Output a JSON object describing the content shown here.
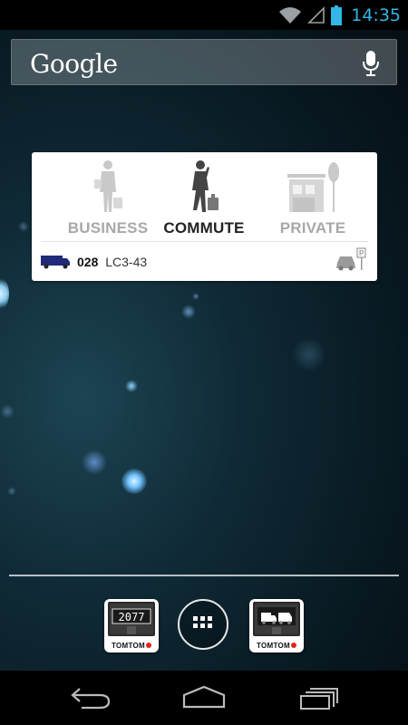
{
  "status_bar": {
    "time": "14:35",
    "icons": [
      "wifi-icon",
      "signal-icon",
      "battery-icon"
    ],
    "accent_color": "#33b5e5"
  },
  "search": {
    "logo_text": "Google",
    "icon": "mic-icon"
  },
  "widget": {
    "modes": [
      {
        "label": "BUSINESS",
        "icon": "businessman-icon",
        "active": false
      },
      {
        "label": "COMMUTE",
        "icon": "commuter-icon",
        "active": true
      },
      {
        "label": "PRIVATE",
        "icon": "house-icon",
        "active": false
      }
    ],
    "route": {
      "number": "028",
      "code": "LC3-43",
      "vehicle_icon": "truck-icon",
      "parking_icon": "car-parking-icon"
    }
  },
  "dock": {
    "apps": [
      {
        "name": "TomTom odometer app",
        "brand": "TOMTOM",
        "screen_text": "2077",
        "icon": "odometer-icon"
      },
      {
        "name": "App drawer",
        "icon": "apps-grid-icon"
      },
      {
        "name": "TomTom fleet app",
        "brand": "TOMTOM",
        "icon": "van-icon"
      }
    ]
  },
  "nav_bar": {
    "buttons": [
      "back-icon",
      "home-icon",
      "recent-apps-icon"
    ]
  }
}
